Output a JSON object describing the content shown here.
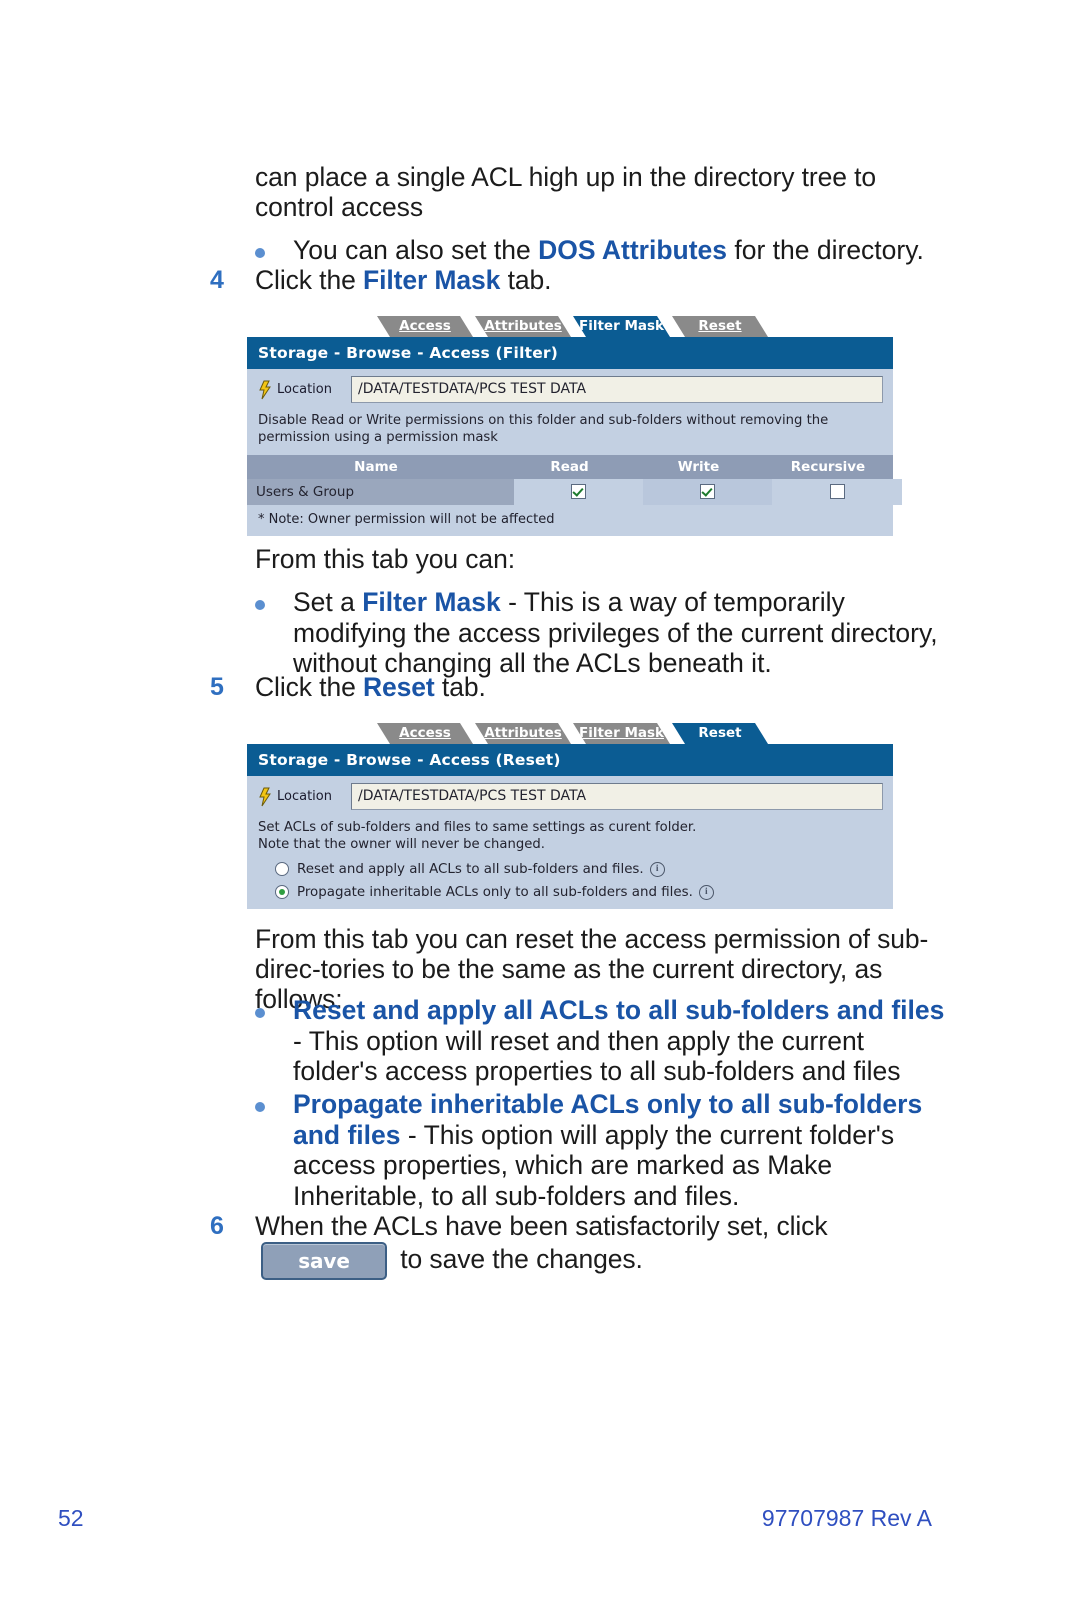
{
  "footer": {
    "page_number": "52",
    "document_id": "97707987 Rev A"
  },
  "prose": {
    "intro_line1": "can place a single ACL high up in the directory tree to",
    "intro_line2": "control access",
    "bullet_dos_prefix": "You can also set the ",
    "bullet_dos_bold": "DOS Attributes",
    "bullet_dos_suffix": " for the directory.",
    "step4_num": "4",
    "step4_prefix": "Click the ",
    "step4_bold": "Filter Mask",
    "step4_suffix": " tab.",
    "from_this_tab": "From this tab you can:",
    "bullet_filter_prefix": "Set a ",
    "bullet_filter_bold": "Filter Mask",
    "bullet_filter_suffix": " - This is a way of temporarily modifying the access privileges of the current directory, without changing all the ACLs beneath it.",
    "step5_num": "5",
    "step5_prefix": "Click the ",
    "step5_bold": "Reset",
    "step5_suffix": " tab.",
    "reset_intro": "From this tab you can reset the access permission of sub-direc-tories to be the same as the current directory, as follows:",
    "bullet_reset_bold": "Reset and apply all ACLs to all sub-folders and files",
    "bullet_reset_text": " - This option will reset and then apply the current folder's access properties to all sub-folders and files",
    "bullet_propagate_bold": "Propagate inheritable ACLs only to all sub-folders and files",
    "bullet_propagate_text": " - This option will apply the current folder's access properties, which are marked as Make Inheritable, to all sub-folders and files.",
    "step6_num": "6",
    "step6_prefix": "When the ACLs have been satisfactorily set, click ",
    "step6_button": "save",
    "step6_suffix": " to save the changes."
  },
  "filter_shot": {
    "tabs": [
      {
        "label": "Access",
        "active": false
      },
      {
        "label": "Attributes",
        "active": false
      },
      {
        "label": "Filter Mask",
        "active": true
      },
      {
        "label": "Reset",
        "active": false
      }
    ],
    "title": "Storage - Browse - Access (Filter)",
    "location_label": "Location",
    "location_value": "/DATA/TESTDATA/PCS TEST DATA",
    "note": "Disable Read or Write permissions on this folder and sub-folders without removing the permission using a permission mask",
    "table": {
      "headers": [
        "Name",
        "Read",
        "Write",
        "Recursive"
      ],
      "rows": [
        {
          "name": "Users & Group",
          "read": true,
          "write": true,
          "recursive": false
        }
      ]
    },
    "footnote": "* Note: Owner permission will not be affected"
  },
  "reset_shot": {
    "tabs": [
      {
        "label": "Access",
        "active": false
      },
      {
        "label": "Attributes",
        "active": false
      },
      {
        "label": "Filter Mask",
        "active": false
      },
      {
        "label": "Reset",
        "active": true
      }
    ],
    "title": "Storage - Browse - Access (Reset)",
    "location_label": "Location",
    "location_value": "/DATA/TESTDATA/PCS TEST DATA",
    "note_line1": "Set ACLs of sub-folders and files to same settings as curent folder.",
    "note_line2": "Note that the owner will never be changed.",
    "options": [
      {
        "label": "Reset and apply all ACLs to all sub-folders and files.",
        "selected": false,
        "info": "i"
      },
      {
        "label": "Propagate inheritable ACLs only to all sub-folders and files.",
        "selected": true,
        "info": "i"
      }
    ]
  },
  "colors": {
    "link_blue": "#1a54a6",
    "step_blue": "#2f6fc0",
    "panel_header": "#0b5c93",
    "panel_body": "#c3d0e2",
    "table_header": "#8e9cb5"
  }
}
